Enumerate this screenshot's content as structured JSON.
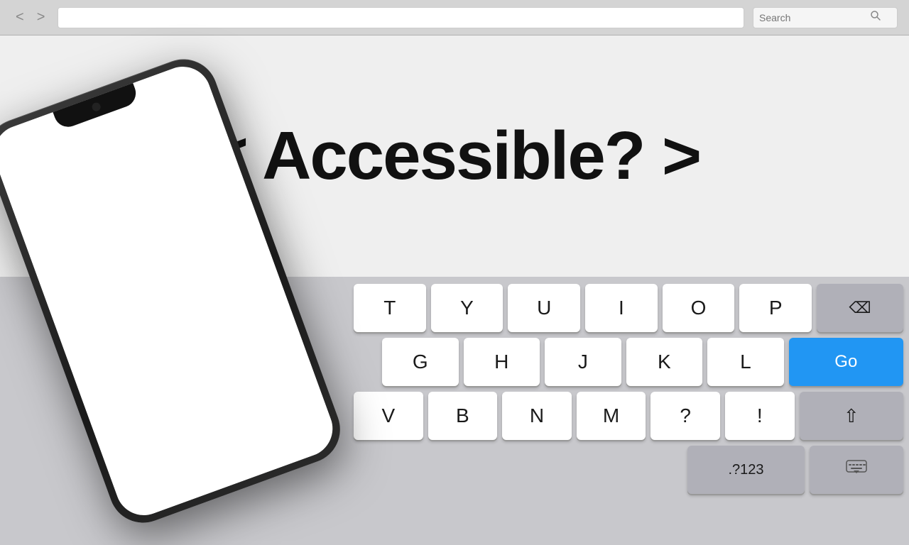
{
  "browser": {
    "back_label": "<",
    "forward_label": ">",
    "address_placeholder": "",
    "search_placeholder": "Search"
  },
  "main": {
    "headline": "< Accessible? >"
  },
  "keyboard": {
    "row1": [
      "T",
      "Y",
      "U",
      "I",
      "O",
      "P"
    ],
    "row2": [
      "G",
      "H",
      "J",
      "K",
      "L"
    ],
    "row3": [
      "V",
      "B",
      "N",
      "M",
      "?",
      "!"
    ],
    "go_label": "Go",
    "numeric_label": ".?123",
    "colors": {
      "go_bg": "#2196F3"
    }
  }
}
